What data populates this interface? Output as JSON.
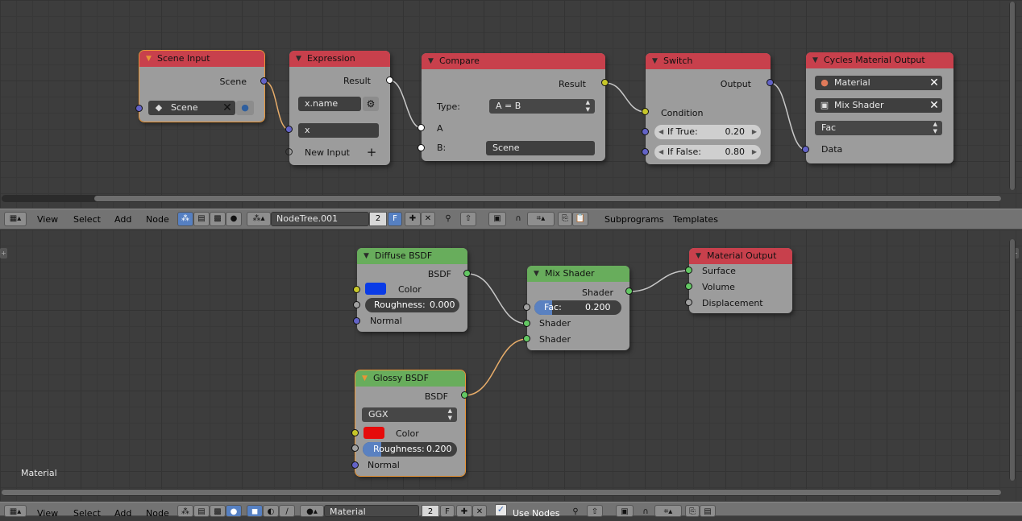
{
  "top_header": {
    "menus": [
      "View",
      "Select",
      "Add",
      "Node"
    ],
    "tree_name": "NodeTree.001",
    "users": "2",
    "fake_user": "F",
    "extra_menus": [
      "Subprograms",
      "Templates"
    ]
  },
  "bottom_header": {
    "menus": [
      "View",
      "Select",
      "Add",
      "Node"
    ],
    "material_name": "Material",
    "users": "2",
    "fake_user": "F",
    "use_nodes_label": "Use Nodes"
  },
  "top_nodes": {
    "scene_input": {
      "title": "Scene Input",
      "out_label": "Scene",
      "field": "Scene"
    },
    "expression": {
      "title": "Expression",
      "out_label": "Result",
      "expr": "x.name",
      "var": "x",
      "new_input": "New Input"
    },
    "compare": {
      "title": "Compare",
      "out_label": "Result",
      "type_label": "Type:",
      "type_value": "A = B",
      "a_label": "A",
      "b_label": "B:",
      "b_value": "Scene"
    },
    "switch": {
      "title": "Switch",
      "out_label": "Output",
      "condition": "Condition",
      "if_true_label": "If True:",
      "if_true_value": "0.20",
      "if_false_label": "If False:",
      "if_false_value": "0.80"
    },
    "cycles_output": {
      "title": "Cycles Material Output",
      "material": "Material",
      "mix_shader": "Mix Shader",
      "fac": "Fac",
      "data": "Data"
    }
  },
  "bottom_nodes": {
    "diffuse": {
      "title": "Diffuse BSDF",
      "out_label": "BSDF",
      "color_label": "Color",
      "roughness_label": "Roughness:",
      "roughness_value": "0.000",
      "roughness_fraction": 0.0,
      "normal_label": "Normal",
      "color": "#0a3be6"
    },
    "glossy": {
      "title": "Glossy BSDF",
      "out_label": "BSDF",
      "distribution": "GGX",
      "color_label": "Color",
      "roughness_label": "Roughness:",
      "roughness_value": "0.200",
      "roughness_fraction": 0.2,
      "normal_label": "Normal",
      "color": "#e60b0b"
    },
    "mix": {
      "title": "Mix Shader",
      "out_label": "Shader",
      "fac_label": "Fac:",
      "fac_value": "0.200",
      "fac_fraction": 0.2,
      "shader1": "Shader",
      "shader2": "Shader"
    },
    "material_output": {
      "title": "Material Output",
      "surface": "Surface",
      "volume": "Volume",
      "displacement": "Displacement"
    }
  },
  "bottom_editor_label": "Material"
}
